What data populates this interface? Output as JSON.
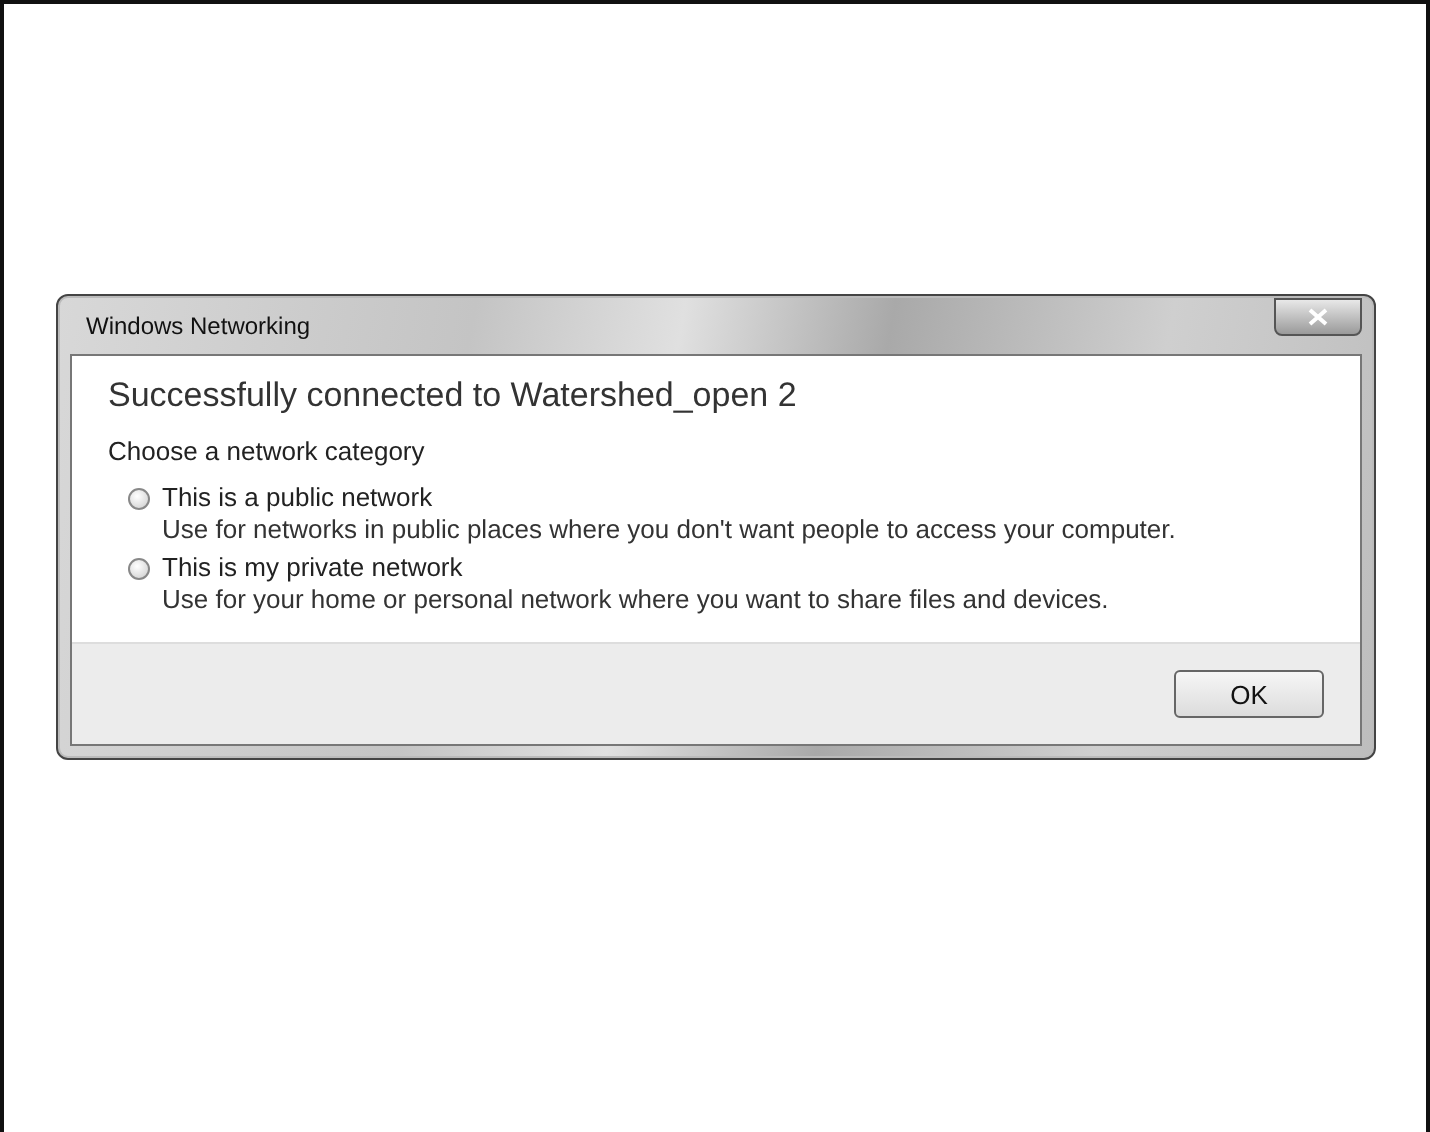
{
  "window": {
    "title": "Windows Networking"
  },
  "heading": "Successfully connected to Watershed_open 2",
  "prompt": "Choose a network category",
  "options": [
    {
      "label": "This is a public network",
      "description": "Use for networks in public places where you don't want people to access your computer.",
      "selected": false
    },
    {
      "label": "This is my private network",
      "description": "Use for your home or personal network where you want to share files and devices.",
      "selected": false
    }
  ],
  "buttons": [
    "OK"
  ]
}
